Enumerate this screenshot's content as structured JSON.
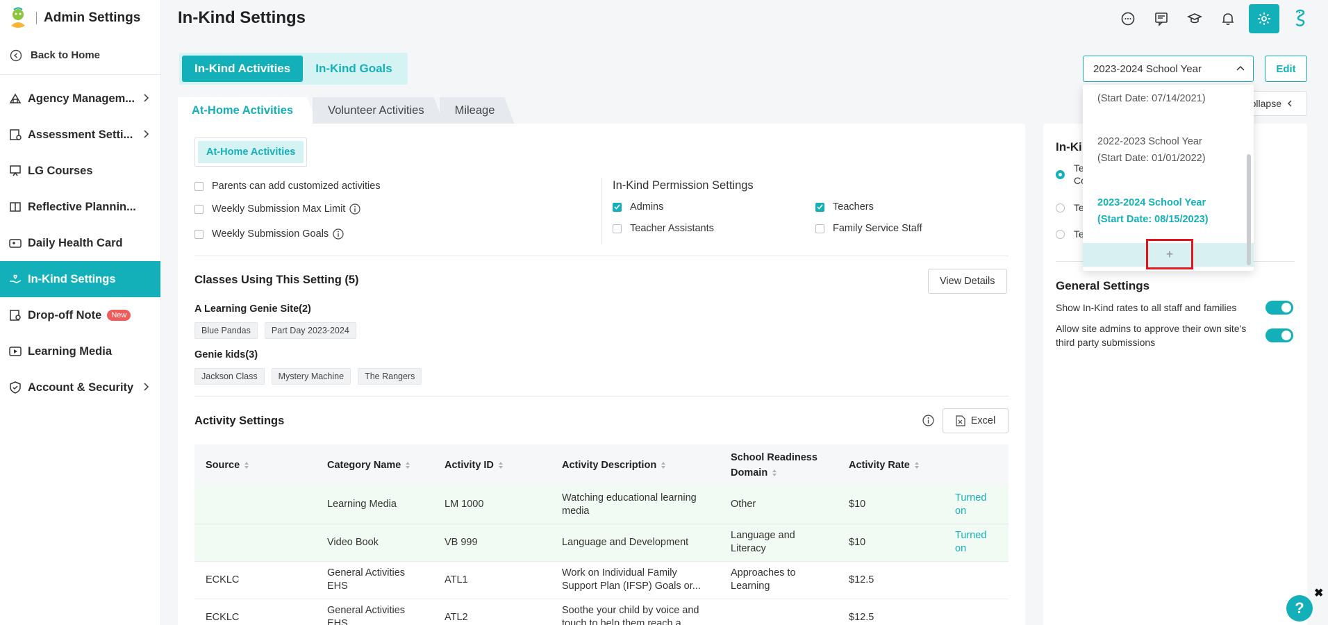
{
  "app": {
    "title": "Admin Settings"
  },
  "sidebar": {
    "back": "Back to Home",
    "items": [
      {
        "label": "Agency Managem...",
        "icon": "agency-icon",
        "has_chevron": true
      },
      {
        "label": "Assessment Setti...",
        "icon": "assessment-icon",
        "has_chevron": true
      },
      {
        "label": "LG Courses",
        "icon": "courses-icon",
        "has_chevron": false
      },
      {
        "label": "Reflective Plannin...",
        "icon": "book-icon",
        "has_chevron": false
      },
      {
        "label": "Daily Health Card",
        "icon": "health-card-icon",
        "has_chevron": false
      },
      {
        "label": "In-Kind Settings",
        "icon": "hand-heart-icon",
        "has_chevron": false,
        "active": true
      },
      {
        "label": "Drop-off Note",
        "icon": "note-icon",
        "has_chevron": false,
        "badge": "New"
      },
      {
        "label": "Learning Media",
        "icon": "media-icon",
        "has_chevron": false
      },
      {
        "label": "Account & Security",
        "icon": "shield-icon",
        "has_chevron": true
      }
    ]
  },
  "header": {
    "title": "In-Kind Settings"
  },
  "mode_tabs": [
    {
      "label": "In-Kind Activities",
      "active": true
    },
    {
      "label": "In-Kind Goals",
      "active": false
    }
  ],
  "year_select": {
    "value": "2023-2024 School Year"
  },
  "edit_label": "Edit",
  "collapse_label": "ollapse",
  "dropdown": {
    "items": [
      {
        "line1": "(Start Date: 07/14/2021)",
        "line2": ""
      },
      {
        "line1": "2022-2023 School Year",
        "line2": "(Start Date: 01/01/2022)"
      },
      {
        "line1": "2023-2024 School Year",
        "line2": "(Start Date: 08/15/2023)",
        "selected": true
      }
    ],
    "add_label": "+"
  },
  "sub_tabs": [
    {
      "label": "At-Home Activities",
      "active": true
    },
    {
      "label": "Volunteer Activities",
      "active": false
    },
    {
      "label": "Mileage",
      "active": false
    }
  ],
  "inner_tab": "At-Home Activities",
  "options": {
    "parents_custom": "Parents can add customized activities",
    "weekly_max": "Weekly Submission Max Limit",
    "weekly_goals": "Weekly Submission Goals"
  },
  "permissions": {
    "title": "In-Kind Permission Settings",
    "admins": "Admins",
    "teachers": "Teachers",
    "teacher_assistants": "Teacher Assistants",
    "family_service": "Family Service Staff"
  },
  "classes": {
    "title": "Classes Using This Setting (5)",
    "view_details": "View Details",
    "sites": [
      {
        "name": "A Learning Genie Site(2)",
        "classes": [
          "Blue Pandas",
          "Part Day 2023-2024"
        ]
      },
      {
        "name": "Genie kids(3)",
        "classes": [
          "Jackson Class",
          "Mystery Machine",
          "The Rangers"
        ]
      }
    ]
  },
  "activity": {
    "title": "Activity Settings",
    "excel": "Excel",
    "columns": [
      "Source",
      "Category Name",
      "Activity ID",
      "Activity Description",
      "School Readiness Domain",
      "Activity Rate",
      ""
    ],
    "rows": [
      {
        "source": "",
        "category": "Learning Media",
        "id": "LM 1000",
        "desc": "Watching educational learning media",
        "domain": "Other",
        "rate": "$10",
        "status": "Turned on",
        "hl": true
      },
      {
        "source": "",
        "category": "Video Book",
        "id": "VB 999",
        "desc": "Language and Development",
        "domain": "Language and Literacy",
        "rate": "$10",
        "status": "Turned on",
        "hl": true
      },
      {
        "source": "ECKLC",
        "category": "General Activities EHS",
        "id": "ATL1",
        "desc": "Work on Individual Family Support Plan (IFSP) Goals or...",
        "domain": "Approaches to Learning",
        "rate": "$12.5",
        "status": "",
        "hl": false
      },
      {
        "source": "ECKLC",
        "category": "General Activities EHS",
        "id": "ATL2",
        "desc": "Soothe your child by voice and touch to help them reach a...",
        "domain": "",
        "rate": "$12.5",
        "status": "",
        "hl": false
      }
    ]
  },
  "right_panel": {
    "title": "In-Ki",
    "radio1_a": "Te",
    "radio1_b": "Co",
    "radio2": "Te",
    "radio3": "Te",
    "general_title": "General Settings",
    "show_rates": "Show In-Kind rates to all staff and families",
    "allow_admins": "Allow site admins to approve their own site's third party submissions"
  },
  "help": "?",
  "close": "✖",
  "colors": {
    "accent": "#14b0b9",
    "highlight_row": "#f2faf4",
    "badge": "#ef5b5b",
    "annotation": "#e0161f"
  }
}
